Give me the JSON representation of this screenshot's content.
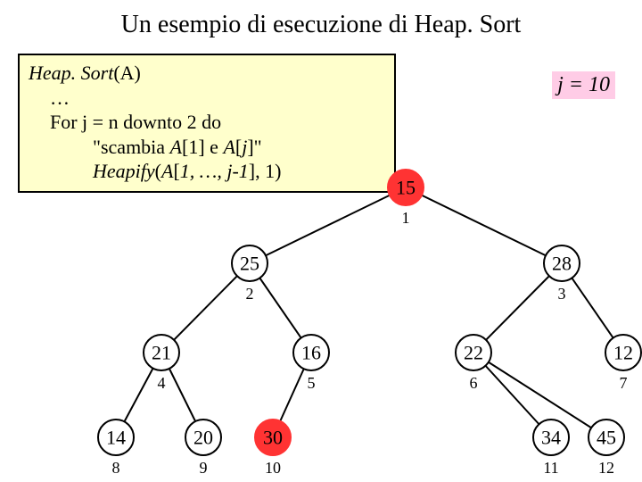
{
  "title": "Un esempio di esecuzione di Heap. Sort",
  "code": {
    "line1a": "Heap. Sort",
    "line1b": "(A)",
    "line2": "…",
    "line3": "For j  = n downto 2 do",
    "line4a": "\"scambia ",
    "line4b": "A",
    "line4c": "[1] e ",
    "line4d": "A",
    "line4e": "[",
    "line4f": "j",
    "line4g": "]\"",
    "line5a": "Heapify",
    "line5b": "(",
    "line5c": "A",
    "line5d": "[",
    "line5e": "1, …, j-1",
    "line5f": "], 1)"
  },
  "j_label": "j = 10",
  "nodes": {
    "n1": {
      "value": "15",
      "index": "1",
      "hl": true
    },
    "n2": {
      "value": "25",
      "index": "2",
      "hl": false
    },
    "n3": {
      "value": "28",
      "index": "3",
      "hl": false
    },
    "n4": {
      "value": "21",
      "index": "4",
      "hl": false
    },
    "n5": {
      "value": "16",
      "index": "5",
      "hl": false
    },
    "n6": {
      "value": "22",
      "index": "6",
      "hl": false
    },
    "n7": {
      "value": "12",
      "index": "7",
      "hl": false
    },
    "n8": {
      "value": "14",
      "index": "8",
      "hl": false
    },
    "n9": {
      "value": "20",
      "index": "9",
      "hl": false
    },
    "n10": {
      "value": "30",
      "index": "10",
      "hl": true
    },
    "n11": {
      "value": "34",
      "index": "11",
      "hl": false
    },
    "n12": {
      "value": "45",
      "index": "12",
      "hl": false
    }
  }
}
